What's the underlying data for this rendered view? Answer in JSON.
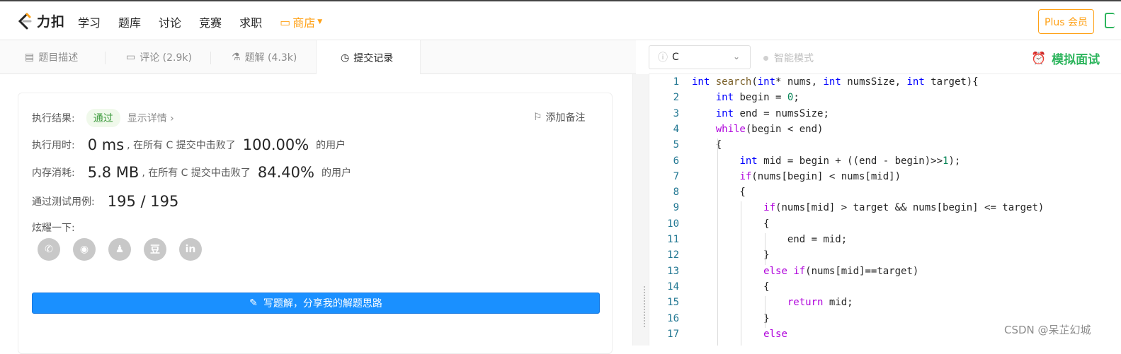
{
  "header": {
    "logo_text": "力扣",
    "nav": [
      "学习",
      "题库",
      "讨论",
      "竞赛",
      "求职"
    ],
    "store_label": "商店",
    "plus_label": "Plus 会员"
  },
  "tabs": [
    {
      "label": "题目描述",
      "icon": "description-icon"
    },
    {
      "label": "评论 (2.9k)",
      "icon": "comment-icon"
    },
    {
      "label": "题解 (4.3k)",
      "icon": "flask-icon"
    },
    {
      "label": "提交记录",
      "icon": "clock-icon",
      "active": true
    }
  ],
  "result": {
    "label": "执行结果:",
    "status": "通过",
    "detail": "显示详情 ›",
    "add_note": "添加备注",
    "time_label": "执行用时:",
    "time_value": "0 ms",
    "time_mid": ", 在所有 C 提交中击败了",
    "time_pct": "100.00%",
    "time_suffix": "的用户",
    "mem_label": "内存消耗:",
    "mem_value": "5.8 MB",
    "mem_mid": ", 在所有 C 提交中击败了",
    "mem_pct": "84.40%",
    "mem_suffix": "的用户",
    "cases_label": "通过测试用例:",
    "cases_value": "195 / 195",
    "share_label": "炫耀一下:",
    "share_icons": [
      "wechat-icon",
      "weibo-icon",
      "qq-icon",
      "douban-icon",
      "linkedin-icon"
    ],
    "share_glyphs": [
      "✆",
      "◉",
      "♟",
      "豆",
      "in"
    ],
    "write_button": "写题解，分享我的解题思路"
  },
  "editor": {
    "language": "C",
    "smart_mode": "智能模式",
    "mock_interview": "模拟面试",
    "lines": [
      "int search(int* nums, int numsSize, int target){",
      "    int begin = 0;",
      "    int end = numsSize;",
      "    while(begin < end)",
      "    {",
      "        int mid = begin + ((end - begin)>>1);",
      "        if(nums[begin] < nums[mid])",
      "        {",
      "            if(nums[mid] > target && nums[begin] <= target)",
      "            {",
      "                end = mid;",
      "            }",
      "            else if(nums[mid]==target)",
      "            {",
      "                return mid;",
      "            }",
      "            else"
    ]
  },
  "watermark": "CSDN @呆芷幻城",
  "colors": {
    "accent_green": "#2db55d",
    "accent_orange": "#ffa116",
    "button_blue": "#1a90ff"
  }
}
